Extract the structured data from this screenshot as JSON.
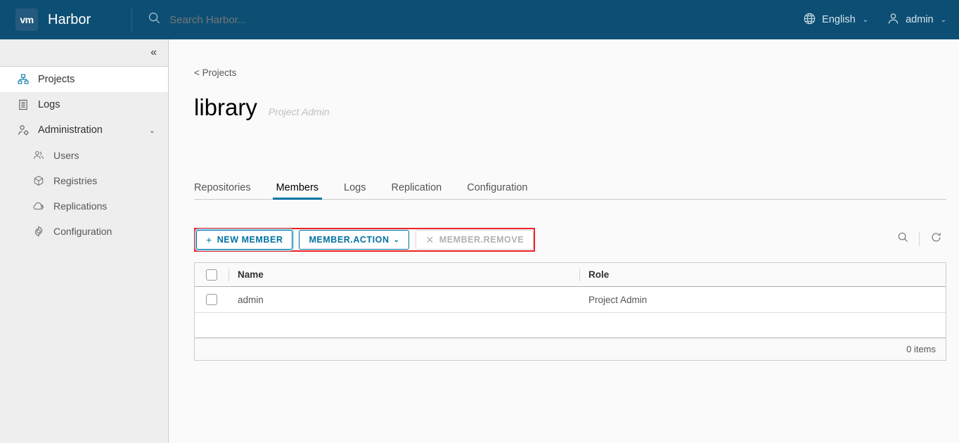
{
  "header": {
    "logo_text": "vm",
    "brand": "Harbor",
    "search_placeholder": "Search Harbor...",
    "search_value": "",
    "search_icon": "search-icon",
    "language": "English",
    "language_icon": "globe-icon",
    "user": "admin",
    "user_icon": "user-icon",
    "caret": "⌄",
    "bg_color": "#0d4f74"
  },
  "sidebar": {
    "collapse_icon": "«",
    "items": [
      {
        "label": "Projects",
        "icon": "projects-icon",
        "active": true,
        "sub": false
      },
      {
        "label": "Logs",
        "icon": "logs-icon",
        "active": false,
        "sub": false
      },
      {
        "label": "Administration",
        "icon": "administration-icon",
        "active": false,
        "sub": false,
        "expandable": true,
        "chevron": "⌄"
      },
      {
        "label": "Users",
        "icon": "users-icon",
        "active": false,
        "sub": true
      },
      {
        "label": "Registries",
        "icon": "registries-icon",
        "active": false,
        "sub": true
      },
      {
        "label": "Replications",
        "icon": "replications-icon",
        "active": false,
        "sub": true
      },
      {
        "label": "Configuration",
        "icon": "configuration-icon",
        "active": false,
        "sub": true
      }
    ]
  },
  "main": {
    "breadcrumb": "< Projects",
    "title": "library",
    "subtitle": "Project Admin",
    "tabs": [
      {
        "label": "Repositories",
        "active": false
      },
      {
        "label": "Members",
        "active": true
      },
      {
        "label": "Logs",
        "active": false
      },
      {
        "label": "Replication",
        "active": false
      },
      {
        "label": "Configuration",
        "active": false
      }
    ],
    "toolbar": {
      "new_member_label": "NEW MEMBER",
      "new_member_glyph": "+",
      "member_action_label": "MEMBER.ACTION",
      "member_action_caret": "⌄",
      "member_remove_label": "MEMBER.REMOVE",
      "member_remove_glyph": "✕",
      "search_icon": "search-icon",
      "refresh_icon": "refresh-icon",
      "highlight_color": "#ed2227"
    },
    "table": {
      "columns": [
        "Name",
        "Role"
      ],
      "rows": [
        {
          "name": "admin",
          "role": "Project Admin"
        }
      ],
      "footer": "0 items"
    }
  },
  "colors": {
    "accent": "#0072a3",
    "header_bg": "#0d4f74",
    "sidebar_bg": "#eeeeee",
    "highlight": "#ed2227"
  }
}
